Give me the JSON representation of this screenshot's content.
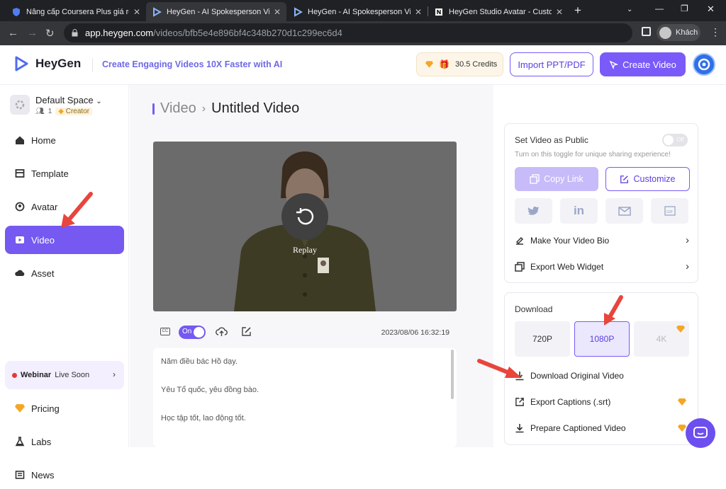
{
  "browser": {
    "tabs": [
      {
        "title": "Nâng cấp Coursera Plus giá rẻ, t..."
      },
      {
        "title": "HeyGen - AI Spokesperson Vide..."
      },
      {
        "title": "HeyGen - AI Spokesperson Vide..."
      },
      {
        "title": "HeyGen Studio Avatar - Custom..."
      }
    ],
    "url_host": "app.heygen.com",
    "url_path": "/videos/bfb5e4e896bf4c348b270d1c299ec6d4",
    "profile_label": "Khách"
  },
  "header": {
    "brand": "HeyGen",
    "tagline": "Create Engaging Videos 10X Faster with AI",
    "credits": "30.5 Credits",
    "import_label": "Import PPT/PDF",
    "create_label": "Create Video"
  },
  "sidebar": {
    "space_name": "Default Space",
    "member_count": "1",
    "plan": "Creator",
    "items": [
      {
        "label": "Home",
        "icon": "home-icon"
      },
      {
        "label": "Template",
        "icon": "template-icon"
      },
      {
        "label": "Avatar",
        "icon": "avatar-icon"
      },
      {
        "label": "Video",
        "icon": "video-icon"
      },
      {
        "label": "Asset",
        "icon": "asset-icon"
      }
    ],
    "webinar_label": "Webinar",
    "webinar_status": "Live Soon",
    "bottom_items": [
      {
        "label": "Pricing",
        "icon": "gem-icon"
      },
      {
        "label": "Labs",
        "icon": "flask-icon"
      },
      {
        "label": "News",
        "icon": "news-icon"
      }
    ]
  },
  "main": {
    "breadcrumb_root": "Video",
    "breadcrumb_current": "Untitled Video",
    "replay_label": "Replay",
    "toggle_label": "On",
    "timestamp": "2023/08/06 16:32:19",
    "script_lines": [
      "Năm điều bác Hồ dạy.",
      "Yêu Tổ quốc, yêu đồng bào.",
      "Học tập tốt, lao động tốt."
    ]
  },
  "share": {
    "public_title": "Set Video as Public",
    "public_toggle": "Off",
    "public_hint": "Turn on this toggle for unique sharing experience!",
    "copy_link": "Copy Link",
    "customize": "Customize",
    "socials": [
      "twitter-icon",
      "linkedin-icon",
      "mail-icon",
      "gif-icon"
    ],
    "bio": "Make Your Video Bio",
    "widget": "Export Web Widget"
  },
  "download": {
    "title": "Download",
    "resolutions": [
      "720P",
      "1080P",
      "4K"
    ],
    "selected": "1080P",
    "original": "Download Original Video",
    "captions": "Export Captions (.srt)",
    "prepare": "Prepare Captioned Video"
  },
  "colors": {
    "accent": "#7a5af8",
    "annotation": "#e8453c",
    "gem": "#f5a623"
  }
}
